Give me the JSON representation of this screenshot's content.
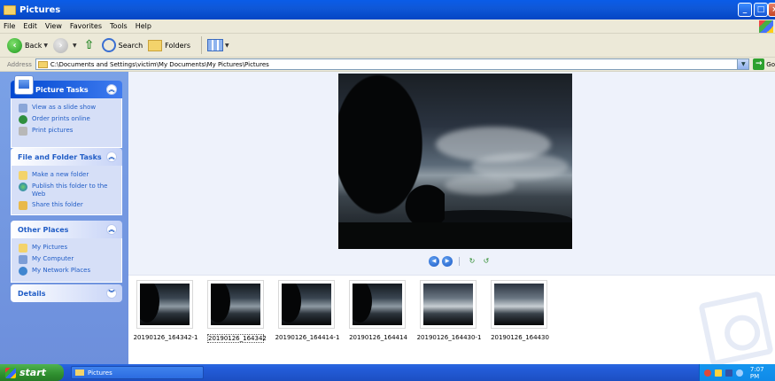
{
  "window": {
    "title": "Pictures",
    "controls": {
      "minimize": "_",
      "maximize": "□",
      "close": "×"
    }
  },
  "menu": [
    "File",
    "Edit",
    "View",
    "Favorites",
    "Tools",
    "Help"
  ],
  "toolbar": {
    "back_label": "Back",
    "search_label": "Search",
    "folders_label": "Folders"
  },
  "address": {
    "label": "Address",
    "path": "C:\\Documents and Settings\\victim\\My Documents\\My Pictures\\Pictures",
    "go_label": "Go"
  },
  "sidebar": {
    "picture_tasks": {
      "title": "Picture Tasks",
      "items": [
        "View as a slide show",
        "Order prints online",
        "Print pictures"
      ]
    },
    "file_folder_tasks": {
      "title": "File and Folder Tasks",
      "items": [
        "Make a new folder",
        "Publish this folder to the Web",
        "Share this folder"
      ]
    },
    "other_places": {
      "title": "Other Places",
      "items": [
        "My Pictures",
        "My Computer",
        "My Network Places"
      ]
    },
    "details": {
      "title": "Details"
    }
  },
  "filmstrip": {
    "selected_index": 1,
    "items": [
      {
        "label": "20190126_164342-1",
        "variant": "dark"
      },
      {
        "label": "20190126_164342",
        "variant": "dark"
      },
      {
        "label": "20190126_164414-1",
        "variant": "dark"
      },
      {
        "label": "20190126_164414",
        "variant": "dark"
      },
      {
        "label": "20190126_164430-1",
        "variant": "light"
      },
      {
        "label": "20190126_164430",
        "variant": "light"
      }
    ]
  },
  "taskbar": {
    "start_label": "start",
    "window_button_label": "Pictures",
    "clock": "7:07 PM"
  },
  "colors": {
    "titlebar_blue": "#0a5ce8",
    "sidebar_blue": "#7aa1e6",
    "link_blue": "#215dc6",
    "start_green": "#2f8f2f",
    "tray_blue": "#1596ef"
  }
}
